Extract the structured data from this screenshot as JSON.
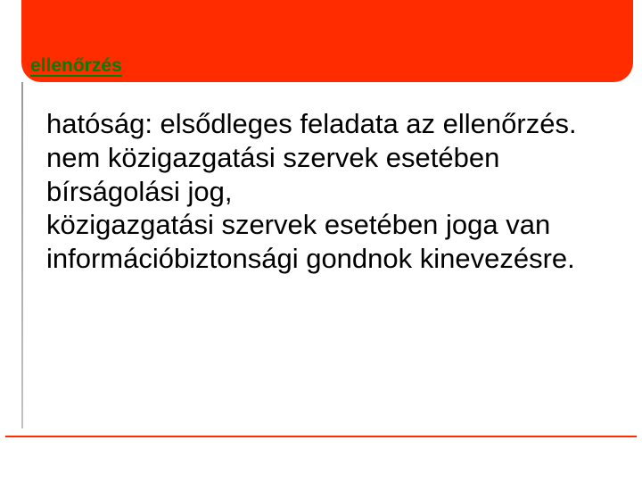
{
  "slide": {
    "title": "ellenőrzés",
    "body_p1": "hatóság: elsődleges feladata az ellenőrzés.",
    "body_p2": "nem közigazgatási szervek esetében bírságolási jog,",
    "body_p3": "közigazgatási szervek esetében joga van információbiztonsági gondnok kinevezésre."
  },
  "colors": {
    "header_bg": "#ff2c00",
    "title_color": "#008000",
    "rule_color": "#ff2c00"
  }
}
